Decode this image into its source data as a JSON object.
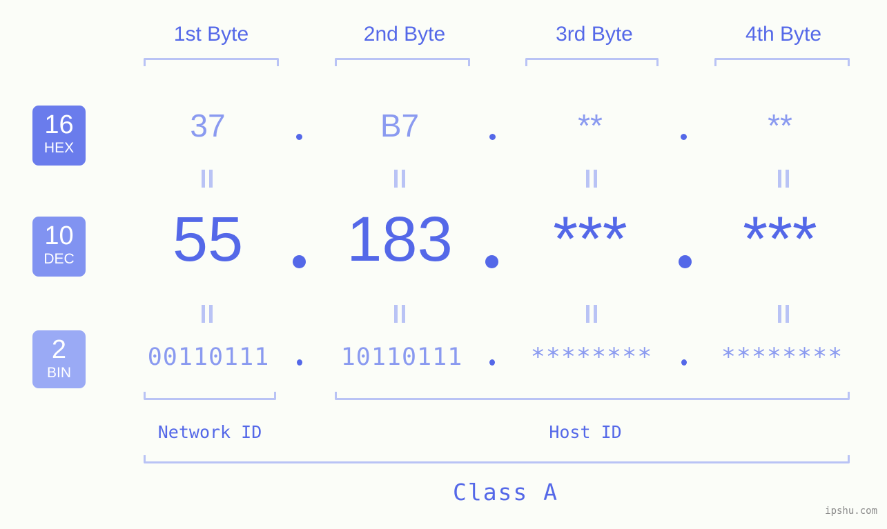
{
  "page": {
    "background_color": "#fbfdf8",
    "accent_color": "#5468e8",
    "accent_light_color": "#8a9af0",
    "bracket_color": "#b9c3f5"
  },
  "headers": [
    {
      "label": "1st Byte"
    },
    {
      "label": "2nd Byte"
    },
    {
      "label": "3rd Byte"
    },
    {
      "label": "4th Byte"
    }
  ],
  "radix_badges": [
    {
      "number": "16",
      "name": "HEX",
      "color": "#6a7cec"
    },
    {
      "number": "10",
      "name": "DEC",
      "color": "#8193f1"
    },
    {
      "number": "2",
      "name": "BIN",
      "color": "#9aaaf5"
    }
  ],
  "rows": {
    "hex": {
      "radix": "16",
      "name": "HEX",
      "values": [
        "37",
        "B7",
        "**",
        "**"
      ],
      "separator": "."
    },
    "dec": {
      "radix": "10",
      "name": "DEC",
      "values": [
        "55",
        "183",
        "***",
        "***"
      ],
      "separator": "."
    },
    "bin": {
      "radix": "2",
      "name": "BIN",
      "values": [
        "00110111",
        "10110111",
        "********",
        "********"
      ],
      "separator": "."
    }
  },
  "equals_marks": {
    "glyph": "=",
    "count_per_gap": 4
  },
  "id_labels": [
    {
      "label": "Network ID"
    },
    {
      "label": "Host ID"
    }
  ],
  "class_label": "Class A",
  "watermark": "ipshu.com"
}
